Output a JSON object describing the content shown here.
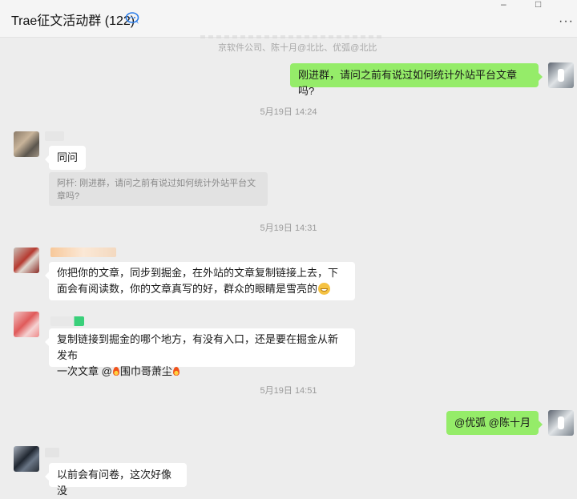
{
  "window": {
    "title": "Trae征文活动群 (122)",
    "ctrl_minimize": "–",
    "ctrl_maximize": "□",
    "more": "···"
  },
  "members_line": "京软件公司、陈十月@北比、优弧@北比",
  "timestamps": [
    "5月19日 14:24",
    "5月19日 14:31",
    "5月19日 14:51"
  ],
  "messages": {
    "m1": {
      "text": "刚进群，请问之前有说过如何统计外站平台文章吗?"
    },
    "m2": {
      "text": "同问",
      "quote": "阿杆: 刚进群，请问之前有说过如何统计外站平台文章吗?"
    },
    "m3": {
      "text": "你把你的文章，同步到掘金，在外站的文章复制链接上去，下面会有阅读数，你的文章真写的好，群众的眼睛是雪亮的"
    },
    "m4": {
      "text_a": "复制链接到掘金的哪个地方，有没有入口，还是要在掘金从新发布",
      "text_b": "一次文章 @",
      "mention": "围巾哥萧尘"
    },
    "m5": {
      "text": "@优弧 @陈十月"
    },
    "m6": {
      "text": "以前会有问卷，这次好像没"
    }
  },
  "colors": {
    "bubble_green": "#95ec69",
    "bubble_white": "#ffffff",
    "background": "#ededed"
  }
}
